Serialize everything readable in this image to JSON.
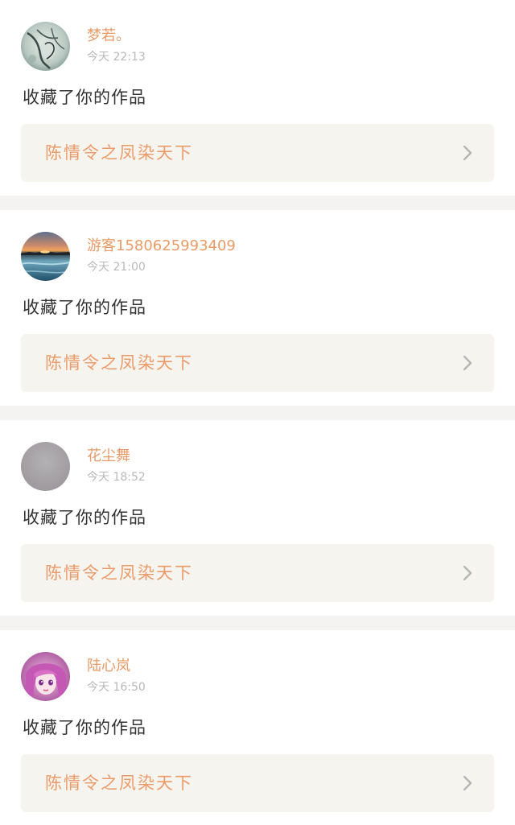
{
  "feed": {
    "items": [
      {
        "username": "梦若。",
        "time": "今天 22:13",
        "action": "收藏了你的作品",
        "work_title": "陈情令之凤染天下",
        "avatar_icon": "ink-painting-avatar"
      },
      {
        "username": "游客1580625993409",
        "time": "今天 21:00",
        "action": "收藏了你的作品",
        "work_title": "陈情令之凤染天下",
        "avatar_icon": "sunset-landscape-avatar"
      },
      {
        "username": "花尘舞",
        "time": "今天 18:52",
        "action": "收藏了你的作品",
        "work_title": "陈情令之凤染天下",
        "avatar_icon": "gray-placeholder-avatar"
      },
      {
        "username": "陆心岚",
        "time": "今天 16:50",
        "action": "收藏了你的作品",
        "work_title": "陈情令之凤染天下",
        "avatar_icon": "anime-girl-avatar"
      }
    ]
  },
  "colors": {
    "page_background": "#f5f3f2",
    "username": "#e99a66",
    "timestamp": "#b9b9b9",
    "action_text": "#333333",
    "work_box_background": "#f5f4ef",
    "work_title": "#eb9b6a",
    "chevron": "#b5b5b5"
  }
}
